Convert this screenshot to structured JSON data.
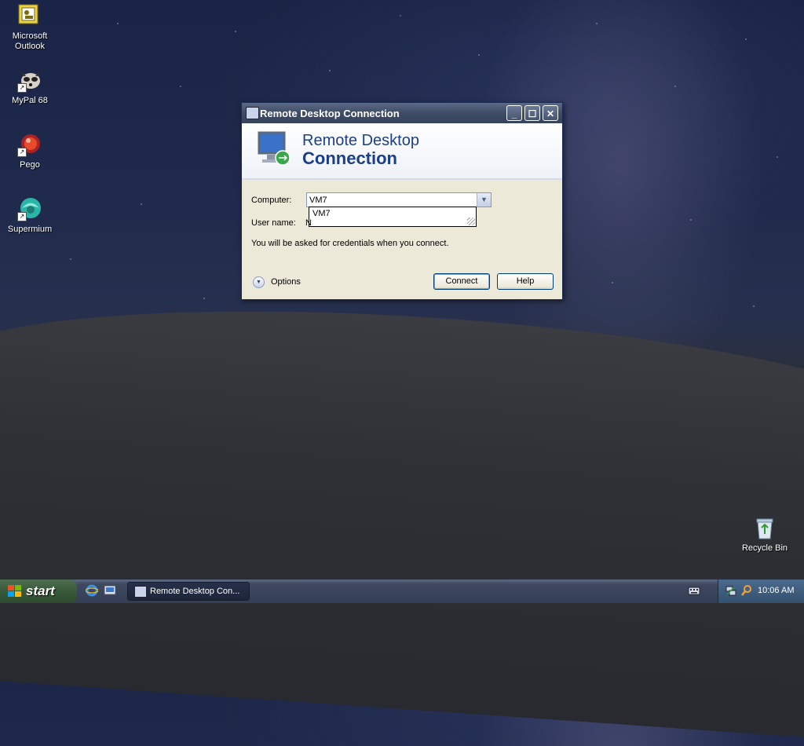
{
  "desktop": {
    "icons": [
      {
        "label": "Microsoft Outlook",
        "icon": "outlook-icon"
      },
      {
        "label": "MyPal 68",
        "icon": "mypal-raccoon-icon"
      },
      {
        "label": "Pego",
        "icon": "pego-icon"
      },
      {
        "label": "Supermium",
        "icon": "supermium-icon"
      },
      {
        "label": "Recycle Bin",
        "icon": "recycle-bin-icon"
      }
    ]
  },
  "dialog": {
    "title": "Remote Desktop Connection",
    "banner_line1": "Remote Desktop",
    "banner_line2": "Connection",
    "computer_label": "Computer:",
    "computer_value": "VM7",
    "autocomplete_option": "VM7",
    "username_label": "User name:",
    "username_value_partial": "N",
    "credentials_note": "You will be asked for credentials when you connect.",
    "options_label": "Options",
    "connect_label": "Connect",
    "help_label": "Help",
    "controls": {
      "minimize": "_",
      "maximize": "☐",
      "close": "✕"
    }
  },
  "taskbar": {
    "start_label": "start",
    "task_label": "Remote Desktop Con...",
    "clock": "10:06 AM"
  },
  "colors": {
    "title_bar": "#3f4c66",
    "banner_text": "#1c3f8a",
    "dialog_bg": "#ece9d8",
    "start_button": "#385a39"
  }
}
